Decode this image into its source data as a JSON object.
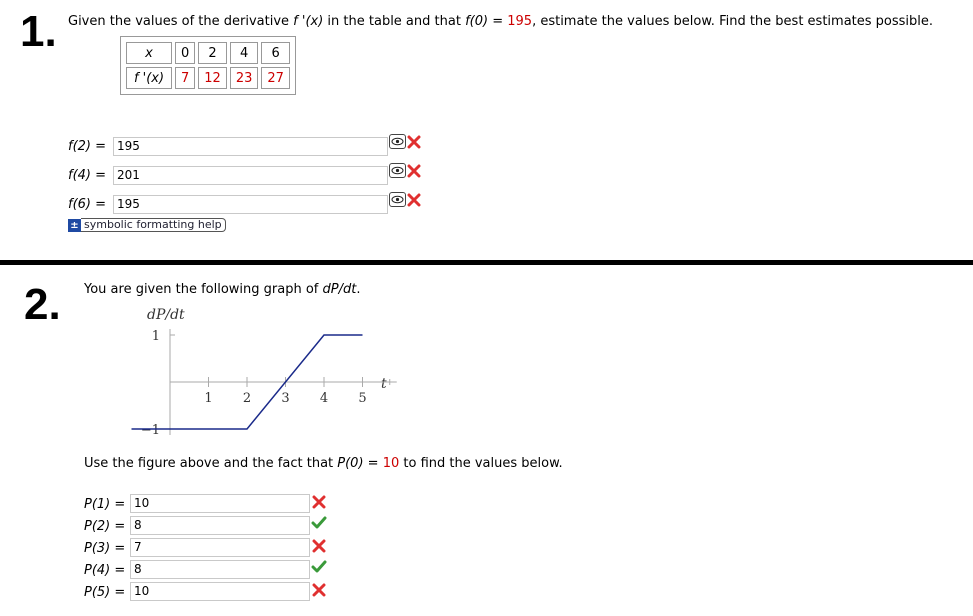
{
  "q1": {
    "number": "1.",
    "prompt_pre": "Given the values of the derivative ",
    "prompt_fp": "f '(x)",
    "prompt_mid": " in the table and that ",
    "prompt_f0": "f(0)",
    "prompt_eq": " = ",
    "prompt_f0_val": "195",
    "prompt_post": ", estimate the values below. Find the best estimates possible.",
    "table": {
      "header_label": "x",
      "row_label": "f '(x)",
      "x": [
        "0",
        "2",
        "4",
        "6"
      ],
      "fp": [
        "7",
        "12",
        "23",
        "27"
      ]
    },
    "answers": [
      {
        "label": "f(2)",
        "eq": "=",
        "value": "195",
        "status": "incorrect"
      },
      {
        "label": "f(4)",
        "eq": "=",
        "value": "201",
        "status": "incorrect"
      },
      {
        "label": "f(6)",
        "eq": "=",
        "value": "195",
        "status": "incorrect"
      }
    ],
    "help_label": "symbolic formatting help",
    "help_icon": "plus-minus-icon"
  },
  "q2": {
    "number": "2.",
    "prompt_pre": "You are given the following graph of ",
    "prompt_var": "dP/dt",
    "prompt_post": ".",
    "after_pre": "Use the figure above and the fact that ",
    "after_p0": "P(0)",
    "after_eq": " = ",
    "after_val": "10",
    "after_post": " to find the values below.",
    "answers": [
      {
        "label": "P(1)",
        "eq": "=",
        "value": "10",
        "status": "incorrect"
      },
      {
        "label": "P(2)",
        "eq": "=",
        "value": "8",
        "status": "correct"
      },
      {
        "label": "P(3)",
        "eq": "=",
        "value": "7",
        "status": "incorrect"
      },
      {
        "label": "P(4)",
        "eq": "=",
        "value": "8",
        "status": "correct"
      },
      {
        "label": "P(5)",
        "eq": "=",
        "value": "10",
        "status": "incorrect"
      }
    ]
  },
  "colors": {
    "red_value": "#cc0000",
    "incorrect": "#e03030",
    "correct": "#3a9a3a",
    "curve": "#1a2a8a"
  },
  "chart_data": {
    "type": "line",
    "ylabel": "dP/dt",
    "xlabel": "t",
    "x_ticks": [
      "1",
      "2",
      "3",
      "4",
      "5"
    ],
    "y_ticks": [
      "1",
      "−1"
    ],
    "xlim": [
      -1,
      5.5
    ],
    "ylim": [
      -1,
      1
    ],
    "series": [
      {
        "x": [
          -1,
          2,
          4,
          5
        ],
        "y": [
          -1,
          -1,
          1,
          1
        ]
      }
    ]
  }
}
